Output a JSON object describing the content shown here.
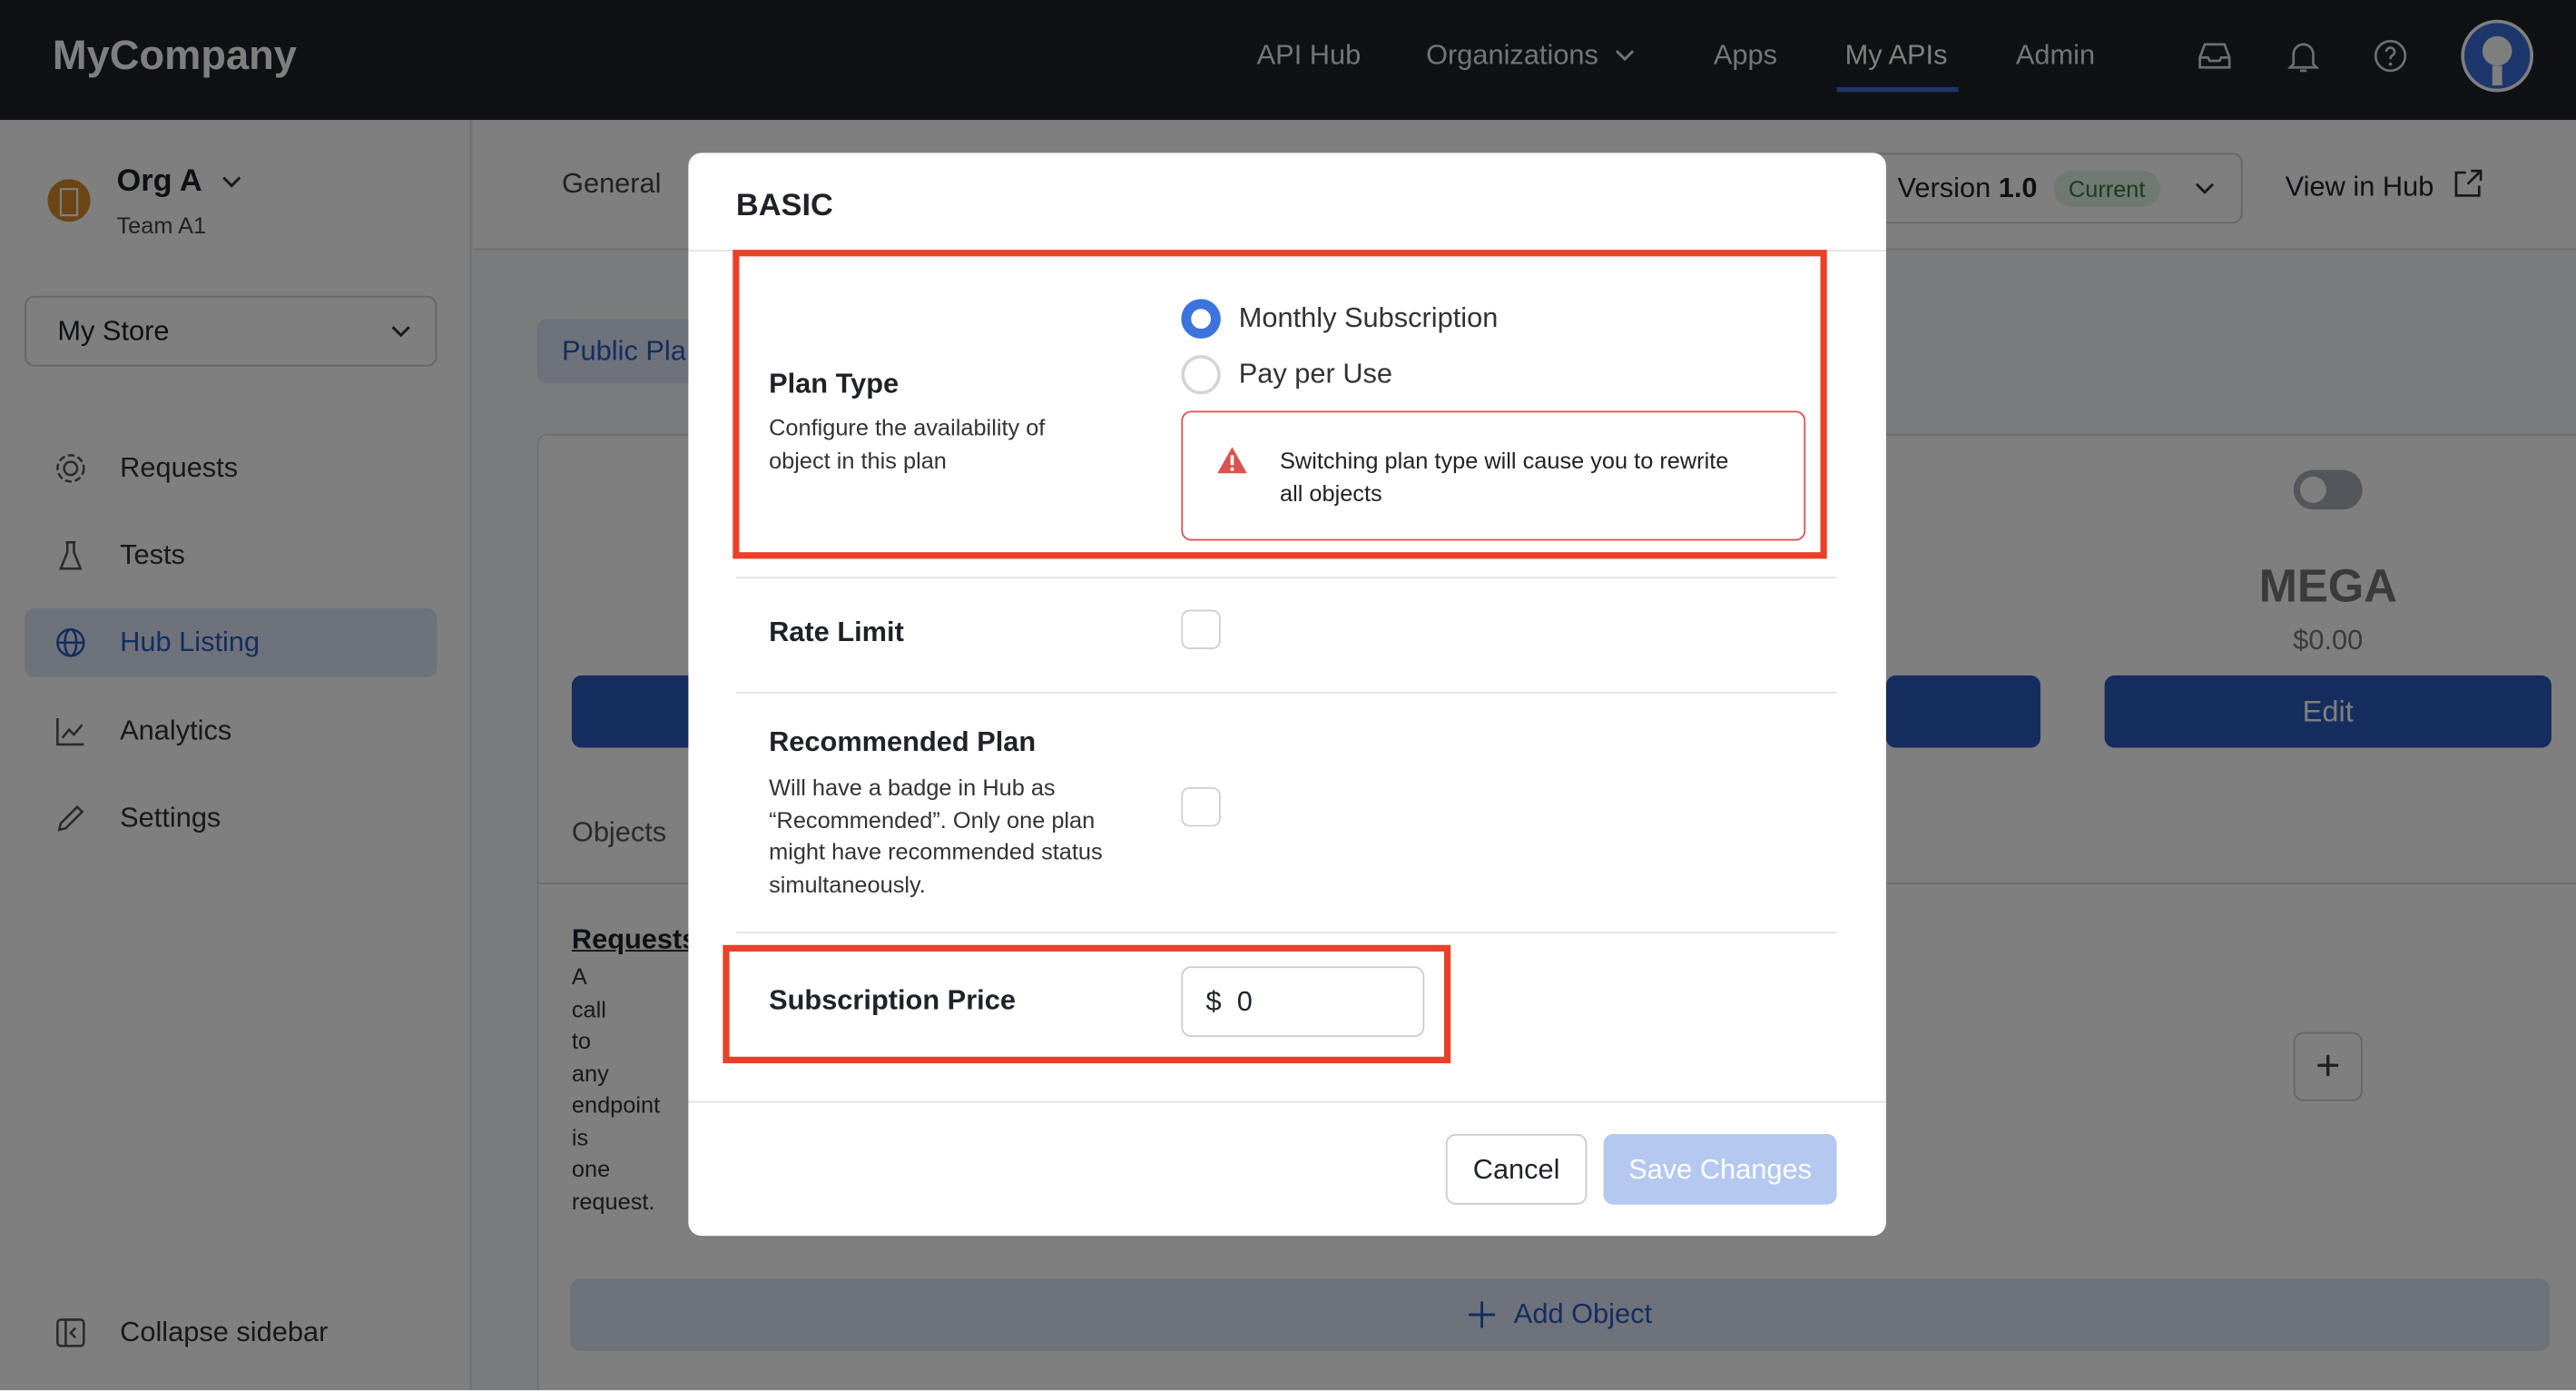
{
  "topbar": {
    "logo": "MyCompany",
    "nav": [
      "API Hub",
      "Organizations",
      "Apps",
      "My APIs",
      "Admin"
    ],
    "active": "My APIs",
    "icons": [
      "inbox-icon",
      "bell-icon",
      "help-icon",
      "avatar"
    ]
  },
  "sidebar": {
    "org_name": "Org A",
    "team": "Team A1",
    "store_select": "My Store",
    "items": [
      {
        "label": "Requests",
        "icon": "requests-icon"
      },
      {
        "label": "Tests",
        "icon": "flask-icon"
      },
      {
        "label": "Hub Listing",
        "icon": "globe-icon",
        "active": true
      },
      {
        "label": "Analytics",
        "icon": "chart-icon"
      },
      {
        "label": "Settings",
        "icon": "pencil-icon"
      }
    ],
    "collapse": "Collapse sidebar"
  },
  "main": {
    "tab_general": "General",
    "version_label": "Version",
    "version": "1.0",
    "version_badge": "Current",
    "view_in_hub": "View in Hub",
    "public_plans": "Public Pla",
    "plan_name": "MEGA",
    "plan_price": "$0.00",
    "plan_edit": "Edit",
    "plan_toggle_on": false,
    "objects_label": "Objects",
    "requests_link": "Requests",
    "requests_desc": [
      "A",
      "call",
      "to",
      "any",
      "endpoint",
      "is",
      "one",
      "request."
    ],
    "add_object": "Add Object"
  },
  "modal": {
    "title": "BASIC",
    "plan_type": {
      "label": "Plan Type",
      "desc": "Configure the availability of object in this plan",
      "options": [
        "Monthly Subscription",
        "Pay per Use"
      ],
      "selected": "Monthly Subscription",
      "warning": "Switching plan type will cause you to rewrite all objects"
    },
    "rate_limit": {
      "label": "Rate Limit",
      "checked": false
    },
    "recommended": {
      "label": "Recommended Plan",
      "desc": "Will have a badge in Hub as “Recommended”. Only one plan might have recommended status simultaneously.",
      "checked": false
    },
    "subscription_price": {
      "label": "Subscription Price",
      "currency": "$",
      "value": "0"
    },
    "cancel": "Cancel",
    "save": "Save Changes"
  },
  "colors": {
    "accent": "#3b74dc",
    "highlight": "#e8412a",
    "warning": "#d9534f",
    "save_disabled": "#b5c8f0"
  }
}
